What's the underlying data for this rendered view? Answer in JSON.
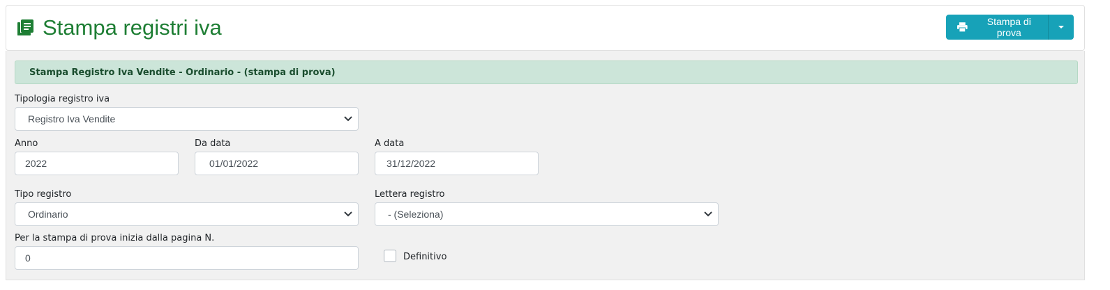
{
  "header": {
    "title": "Stampa registri iva",
    "icon": "book-icon",
    "print_button_label": "Stampa di prova",
    "accent": "#17a2b8",
    "title_color": "#1e7e34"
  },
  "alert": {
    "text": "Stampa Registro Iva Vendite - Ordinario - (stampa di prova)"
  },
  "form": {
    "tipologia_label": "Tipologia registro iva",
    "tipologia_value": "Registro Iva Vendite",
    "anno_label": "Anno",
    "anno_value": "2022",
    "da_data_label": "Da data",
    "da_data_value": "01/01/2022",
    "a_data_label": "A data",
    "a_data_value": "31/12/2022",
    "tipo_registro_label": "Tipo registro",
    "tipo_registro_value": "Ordinario",
    "lettera_label": "Lettera registro",
    "lettera_value": "- (Seleziona)",
    "pagina_label": "Per la stampa di prova inizia dalla pagina N.",
    "pagina_value": "0",
    "definitivo_label": "Definitivo"
  }
}
